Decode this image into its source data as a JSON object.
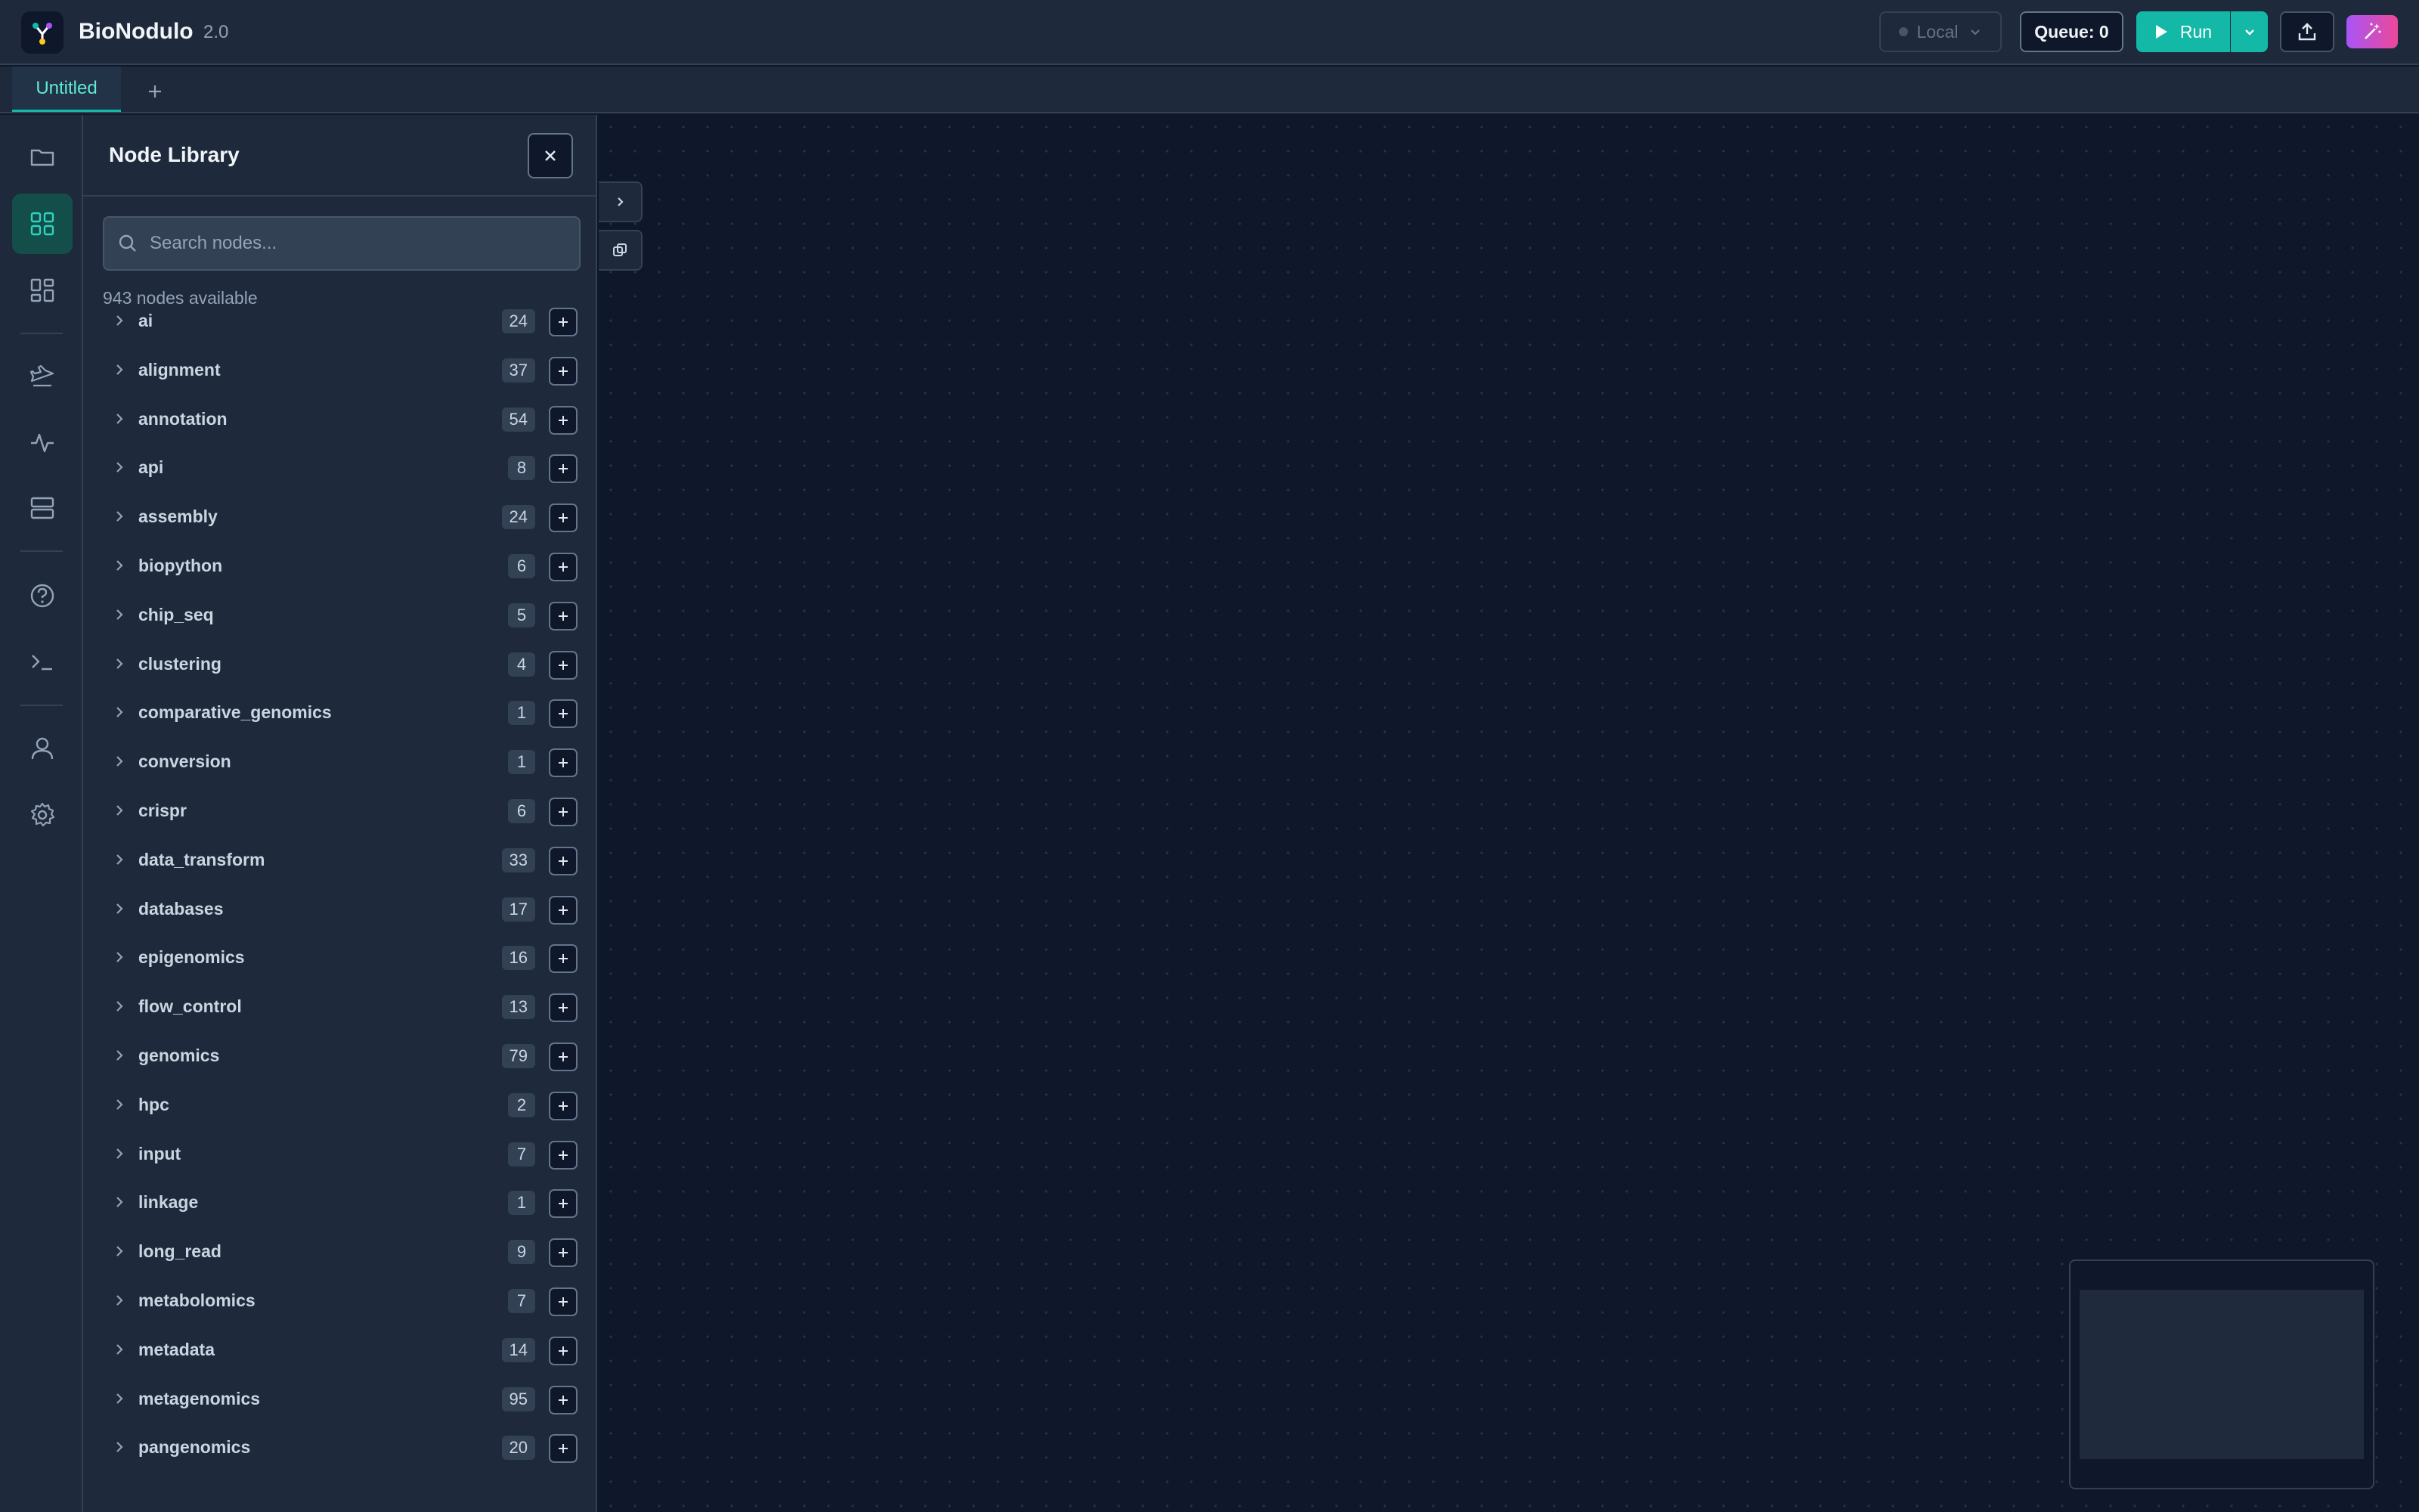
{
  "app": {
    "name": "BioNodulo",
    "version": "2.0"
  },
  "header": {
    "environment": "Local",
    "queue_label": "Queue: 0",
    "run_label": "Run"
  },
  "tabs": [
    {
      "label": "Untitled",
      "active": true
    }
  ],
  "sidebar": {
    "items": [
      {
        "icon": "folder-icon",
        "active": false
      },
      {
        "icon": "node-library-icon",
        "active": true
      },
      {
        "icon": "templates-icon",
        "active": false
      },
      {
        "icon": "plane-icon",
        "active": false
      },
      {
        "icon": "activity-icon",
        "active": false
      },
      {
        "icon": "server-icon",
        "active": false
      },
      {
        "icon": "help-icon",
        "active": false
      },
      {
        "icon": "terminal-icon",
        "active": false
      },
      {
        "icon": "user-icon",
        "active": false
      },
      {
        "icon": "settings-icon",
        "active": false
      }
    ]
  },
  "node_library": {
    "title": "Node Library",
    "search_placeholder": "Search nodes...",
    "available_text": "943 nodes available",
    "categories": [
      {
        "name": "ai",
        "count": "24"
      },
      {
        "name": "alignment",
        "count": "37"
      },
      {
        "name": "annotation",
        "count": "54"
      },
      {
        "name": "api",
        "count": "8"
      },
      {
        "name": "assembly",
        "count": "24"
      },
      {
        "name": "biopython",
        "count": "6"
      },
      {
        "name": "chip_seq",
        "count": "5"
      },
      {
        "name": "clustering",
        "count": "4"
      },
      {
        "name": "comparative_genomics",
        "count": "1"
      },
      {
        "name": "conversion",
        "count": "1"
      },
      {
        "name": "crispr",
        "count": "6"
      },
      {
        "name": "data_transform",
        "count": "33"
      },
      {
        "name": "databases",
        "count": "17"
      },
      {
        "name": "epigenomics",
        "count": "16"
      },
      {
        "name": "flow_control",
        "count": "13"
      },
      {
        "name": "genomics",
        "count": "79"
      },
      {
        "name": "hpc",
        "count": "2"
      },
      {
        "name": "input",
        "count": "7"
      },
      {
        "name": "linkage",
        "count": "1"
      },
      {
        "name": "long_read",
        "count": "9"
      },
      {
        "name": "metabolomics",
        "count": "7"
      },
      {
        "name": "metadata",
        "count": "14"
      },
      {
        "name": "metagenomics",
        "count": "95"
      },
      {
        "name": "pangenomics",
        "count": "20"
      }
    ]
  },
  "colors": {
    "accent": "#14b8a6",
    "background": "#0f172a",
    "panel": "#1e293b",
    "border": "#334155"
  }
}
